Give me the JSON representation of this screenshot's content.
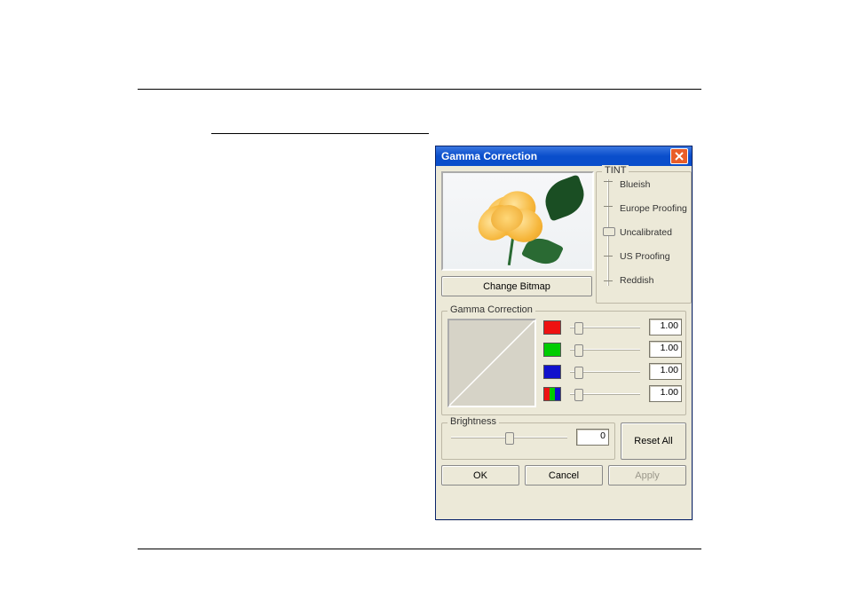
{
  "dialog": {
    "title": "Gamma Correction",
    "preview": {
      "change_bitmap_label": "Change Bitmap"
    },
    "tint": {
      "legend": "TINT",
      "options": [
        "Blueish",
        "Europe Proofing",
        "Uncalibrated",
        "US Proofing",
        "Reddish"
      ],
      "selected_index": 2
    },
    "gamma": {
      "legend": "Gamma Correction",
      "channels": [
        {
          "color": "red",
          "value": "1.00",
          "slider_pos": 0.12
        },
        {
          "color": "green",
          "value": "1.00",
          "slider_pos": 0.12
        },
        {
          "color": "blue",
          "value": "1.00",
          "slider_pos": 0.12
        },
        {
          "color": "rgb",
          "value": "1.00",
          "slider_pos": 0.12
        }
      ]
    },
    "brightness": {
      "legend": "Brightness",
      "value": "0",
      "slider_pos": 0.5
    },
    "buttons": {
      "reset_all": "Reset All",
      "ok": "OK",
      "cancel": "Cancel",
      "apply": "Apply"
    }
  }
}
